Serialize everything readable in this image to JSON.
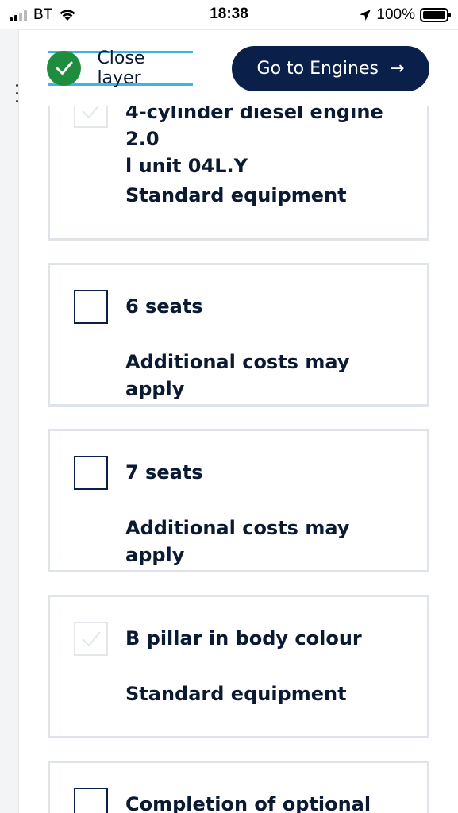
{
  "status_bar": {
    "carrier": "BT",
    "time": "18:38",
    "battery": "100%"
  },
  "header": {
    "close_label": "Close layer",
    "go_label": "Go to Engines",
    "go_arrow": "→"
  },
  "options": [
    {
      "title_line1": "4-cylinder diesel engine 2.0",
      "title_line2": "l unit 04L.Y",
      "subtitle": "Standard equipment",
      "checked": true,
      "disabled": true
    },
    {
      "title": "6 seats",
      "subtitle": "Additional costs may apply",
      "checked": false,
      "disabled": false
    },
    {
      "title": "7 seats",
      "subtitle": "Additional costs may apply",
      "checked": false,
      "disabled": false
    },
    {
      "title": "B pillar in body colour",
      "subtitle": "Standard equipment",
      "checked": true,
      "disabled": true
    },
    {
      "title": "Completion of optional",
      "checked": false,
      "disabled": false
    }
  ],
  "colors": {
    "accent_blue": "#0b1f4b",
    "close_underline": "#39b5e6",
    "check_green": "#1e8e3e",
    "card_border": "#dfe4ea"
  },
  "icons": {
    "close_check": "check-circle-icon",
    "go_arrow": "arrow-right-icon"
  }
}
